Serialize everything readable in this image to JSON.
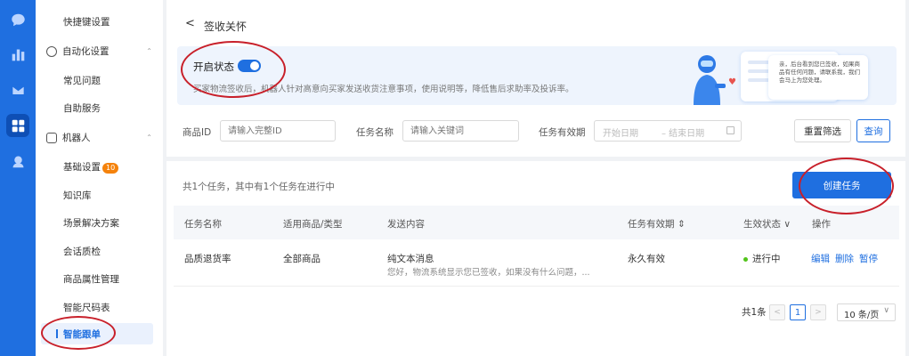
{
  "rail": {
    "icons": [
      "chat-icon",
      "chart-icon",
      "mail-icon",
      "apps-icon",
      "service-icon"
    ]
  },
  "sidebar": {
    "items": {
      "shortcut": "快捷键设置",
      "automation": "自动化设置",
      "faq": "常见问题",
      "self_service": "自助服务",
      "robot": "机器人",
      "basic_settings": "基础设置",
      "basic_badge": "10",
      "knowledge": "知识库",
      "scenario": "场景解决方案",
      "qa": "会话质检",
      "attributes": "商品属性管理",
      "size_chart": "智能尺码表",
      "smart_follow": "智能跟单"
    }
  },
  "header": {
    "back": "<",
    "title": "签收关怀"
  },
  "banner": {
    "title": "开启状态",
    "enabled": true,
    "desc": "买家物流签收后，机器人针对高意向买家发送收货注意事项，使用说明等，降低售后求助率及投诉率。",
    "bubble_text": "亲，后台看到您已签收，如果商品有任何问题，请联系我，我们会马上为您处理。"
  },
  "filters": {
    "product_id_label": "商品ID",
    "product_id_placeholder": "请输入完整ID",
    "task_name_label": "任务名称",
    "task_name_placeholder": "请输入关键词",
    "validity_label": "任务有效期",
    "start_placeholder": "开始日期",
    "end_placeholder": "– 结束日期",
    "reset": "重置筛选",
    "query": "查询"
  },
  "tasks": {
    "summary": "共1个任务，其中有1个任务在进行中",
    "create": "创建任务",
    "columns": [
      "任务名称",
      "适用商品/类型",
      "发送内容",
      "任务有效期 ⇕",
      "生效状态 ∨",
      "操作"
    ],
    "rows": [
      {
        "name": "品质退货率",
        "products": "全部商品",
        "content_type": "纯文本消息",
        "content_preview": "您好，物流系统显示您已签收，如果没有什么问题，...",
        "validity": "永久有效",
        "status": "进行中",
        "actions": [
          "编辑",
          "删除",
          "暂停"
        ]
      }
    ]
  },
  "pagination": {
    "total": "共1条",
    "prev": "<",
    "page": "1",
    "next": ">",
    "page_size": "10 条/页",
    "chevron": "∨"
  },
  "colors": {
    "primary": "#1f6fe0",
    "annotation": "#c8202a",
    "status_green": "#52c41a",
    "badge": "#f5820b"
  }
}
